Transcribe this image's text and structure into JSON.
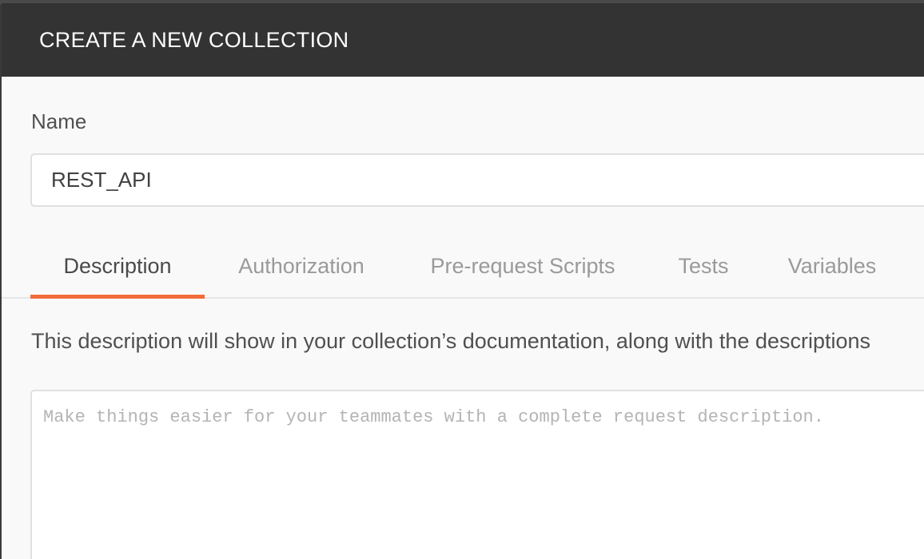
{
  "modal": {
    "title": "CREATE A NEW COLLECTION"
  },
  "name_field": {
    "label": "Name",
    "value": "REST_API"
  },
  "tabs": [
    {
      "label": "Description",
      "active": true
    },
    {
      "label": "Authorization",
      "active": false
    },
    {
      "label": "Pre-request Scripts",
      "active": false
    },
    {
      "label": "Tests",
      "active": false
    },
    {
      "label": "Variables",
      "active": false
    }
  ],
  "description": {
    "help_text": "This description will show in your collection’s documentation, along with the descriptions",
    "placeholder": "Make things easier for your teammates with a complete request description.",
    "value": ""
  },
  "colors": {
    "header_bg": "#333333",
    "accent": "#f26b3a",
    "active_tab_text": "#4a4a4a",
    "inactive_tab_text": "#9a9a9a"
  }
}
